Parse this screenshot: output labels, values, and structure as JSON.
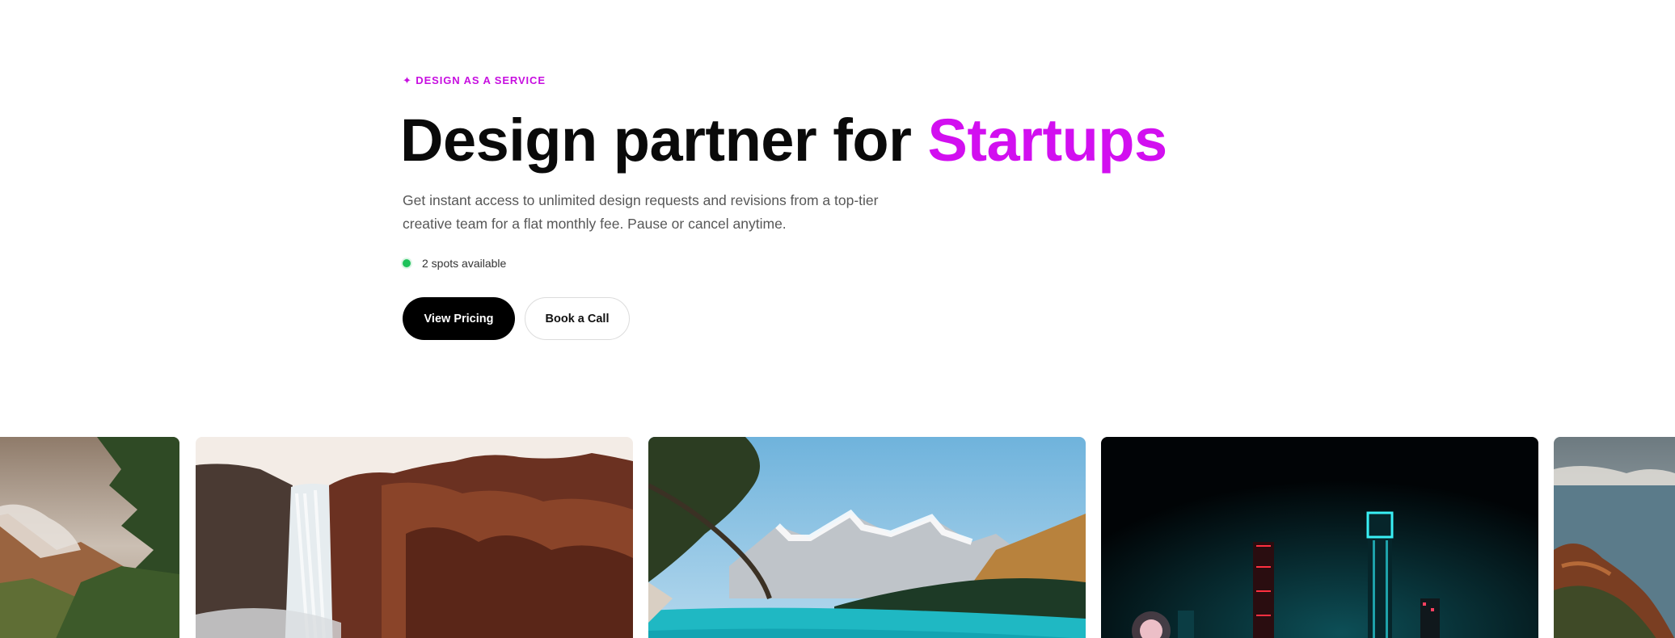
{
  "hero": {
    "eyebrow_icon": "sparkle-icon",
    "eyebrow": "✦ DESIGN AS A SERVICE",
    "headline_main": "Design partner for ",
    "headline_accent": "Startups",
    "subtitle": "Get instant access to unlimited design requests and revisions from a top-tier creative team for a flat monthly fee. Pause or cancel anytime.",
    "availability": "2 spots available",
    "primary_cta": "View Pricing",
    "secondary_cta": "Book a Call"
  },
  "colors": {
    "accent": "#d20ff0",
    "status_dot": "#1ec25a",
    "primary_button": "#000000"
  },
  "gallery": {
    "images": [
      {
        "name": "mountain-cliffs-image",
        "subject": "misty green mountain ridge"
      },
      {
        "name": "waterfall-image",
        "subject": "waterfall beside red rock cliff"
      },
      {
        "name": "lake-mountains-image",
        "subject": "turquoise lake under snowy peaks"
      },
      {
        "name": "night-city-image",
        "subject": "neon city towers at night"
      },
      {
        "name": "coastline-image",
        "subject": "coastal cliffs above the sea"
      }
    ]
  }
}
